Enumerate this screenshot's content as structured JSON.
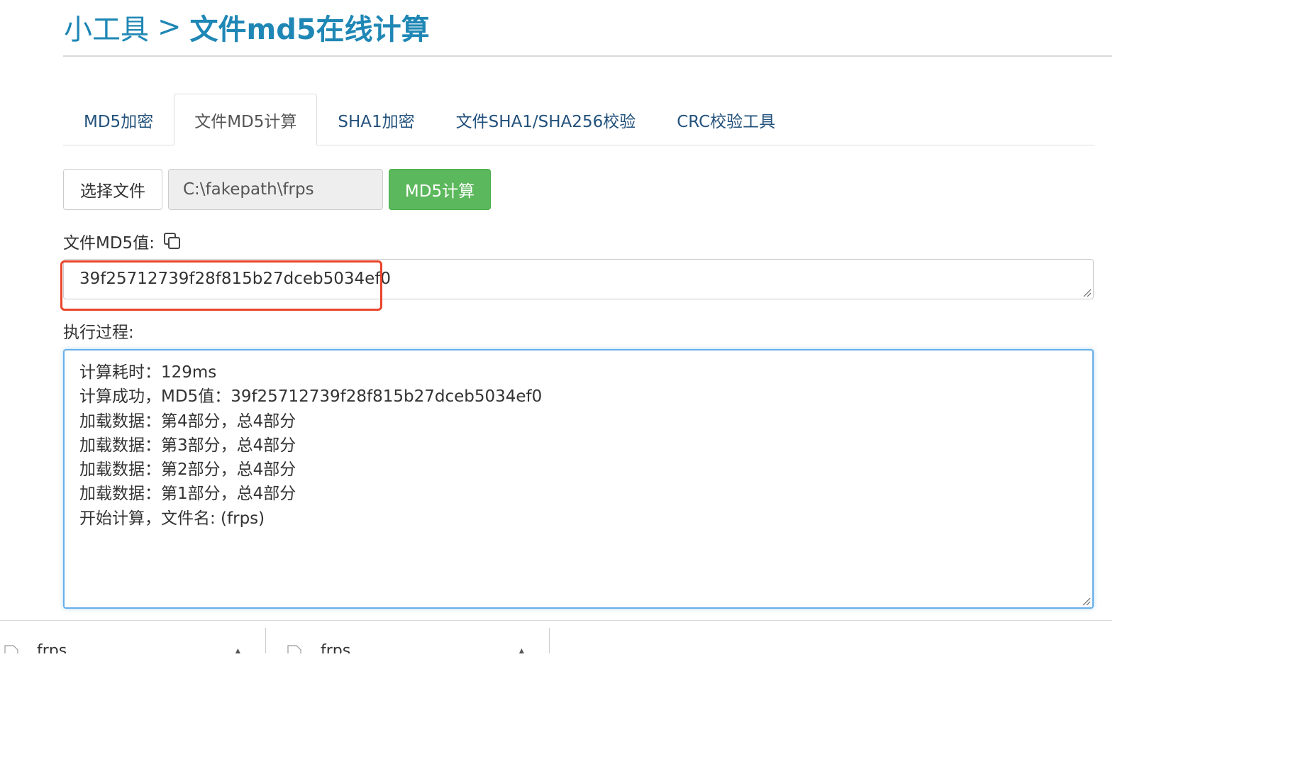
{
  "header": {
    "breadcrumb_root": "小工具",
    "breadcrumb_separator": ">",
    "breadcrumb_current": "文件md5在线计算"
  },
  "tabs": [
    {
      "label": "MD5加密",
      "active": false
    },
    {
      "label": "文件MD5计算",
      "active": true
    },
    {
      "label": "SHA1加密",
      "active": false
    },
    {
      "label": "文件SHA1/SHA256校验",
      "active": false
    },
    {
      "label": "CRC校验工具",
      "active": false
    }
  ],
  "file_picker": {
    "choose_label": "选择文件",
    "path_value": "C:\\fakepath\\frps",
    "compute_label": "MD5计算"
  },
  "result": {
    "label": "文件MD5值:",
    "value": "39f25712739f28f815b27dceb5034ef0"
  },
  "process": {
    "label": "执行过程:",
    "lines": [
      "计算耗时：129ms",
      "计算成功，MD5值：39f25712739f28f815b27dceb5034ef0",
      "加载数据：第4部分，总4部分",
      "加载数据：第3部分，总4部分",
      "加载数据：第2部分，总4部分",
      "加载数据：第1部分，总4部分",
      "开始计算，文件名: (frps)"
    ]
  },
  "downloads": [
    {
      "name": "frps"
    },
    {
      "name": "frps"
    }
  ],
  "colors": {
    "title": "#1f87b5",
    "tab_link": "#23527c",
    "success": "#5cb85c",
    "highlight": "#e8452c",
    "focus_border": "#66afe9"
  },
  "icons": {
    "copy": "copy-icon",
    "file": "file-icon",
    "resize": "resize-grip-icon",
    "caret": "chevron-up-icon"
  }
}
